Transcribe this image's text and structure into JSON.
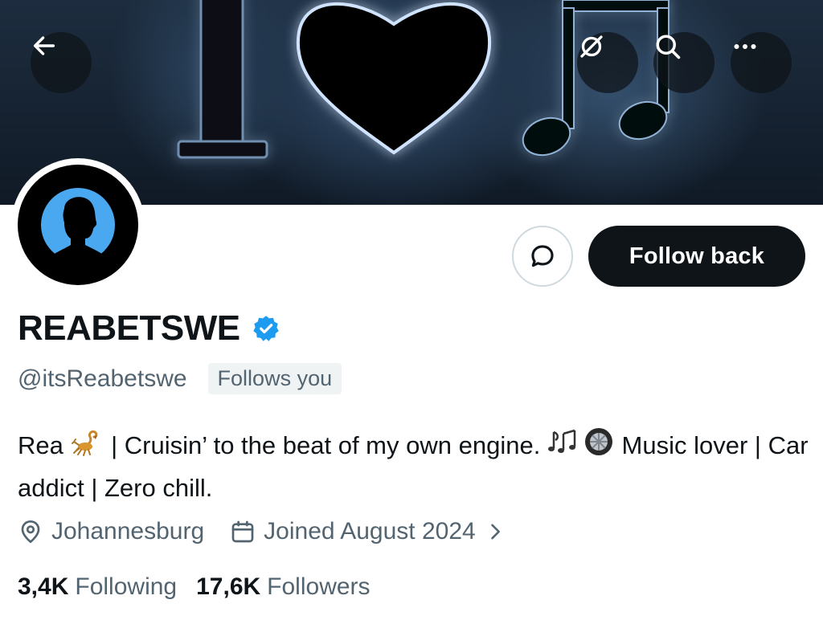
{
  "header": {
    "back_icon": "arrow-left-icon",
    "grok_icon": "grok-icon",
    "search_icon": "search-icon",
    "more_icon": "more-horizontal-icon"
  },
  "banner": {
    "description_icons": [
      "letter-I",
      "heart",
      "music-notes"
    ]
  },
  "profile": {
    "display_name": "REABETSWE",
    "verified": true,
    "handle": "@itsReabetswe",
    "follows_you_label": "Follows you",
    "bio_parts": {
      "name": "Rea",
      "text1": " | Cruisin’ to the beat of my own engine. ",
      "text2": " Music lover | Car addict | Zero chill."
    },
    "location": "Johannesburg",
    "joined": "Joined August 2024",
    "following_count": "3,4K",
    "following_label": "Following",
    "followers_count": "17,6K",
    "followers_label": "Followers"
  },
  "actions": {
    "message_icon": "message-bubble-icon",
    "follow_back_label": "Follow back"
  },
  "colors": {
    "accent": "#0f1419",
    "muted": "#536471",
    "verified_blue": "#1d9bf0",
    "avatar_blue": "#4aa8f0"
  }
}
